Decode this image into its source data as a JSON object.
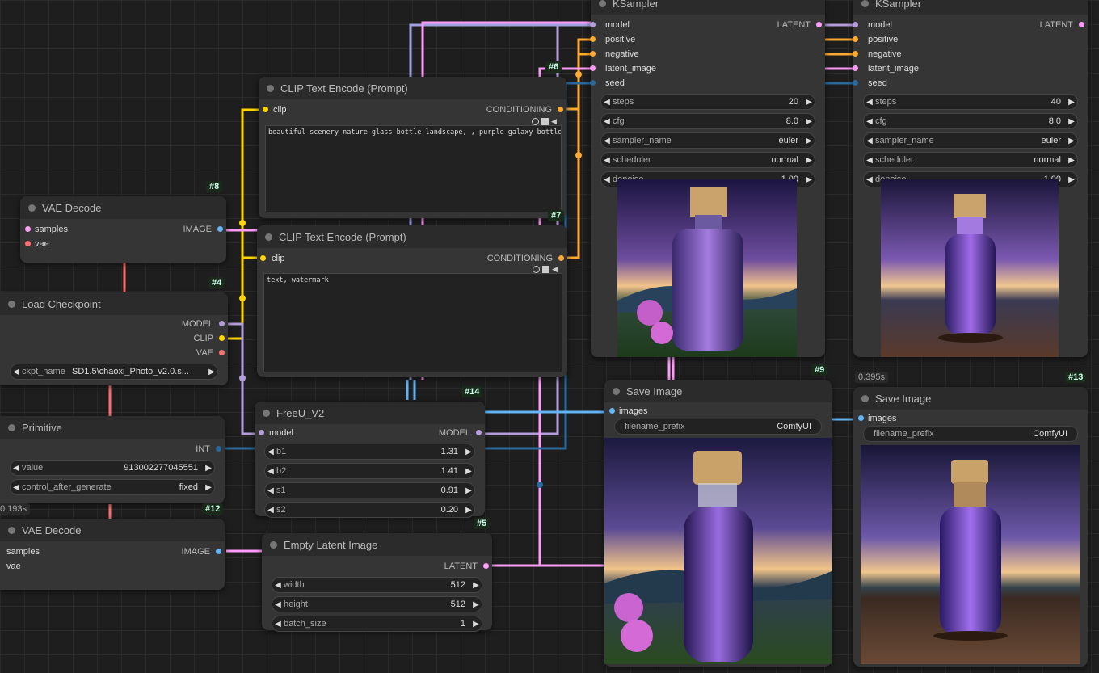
{
  "colors": {
    "model": "#b39ddb",
    "clip": "#ffd500",
    "conditioning": "#ffa931",
    "latent": "#ff9cf9",
    "image": "#64b5f6",
    "vae": "#ff6e6e",
    "int": "#29699c"
  },
  "ksampler_a": {
    "title": "KSampler",
    "output": "LATENT",
    "inputs": [
      "model",
      "positive",
      "negative",
      "latent_image",
      "seed"
    ],
    "widgets": [
      {
        "label": "steps",
        "value": "20"
      },
      {
        "label": "cfg",
        "value": "8.0"
      },
      {
        "label": "sampler_name",
        "value": "euler"
      },
      {
        "label": "scheduler",
        "value": "normal"
      },
      {
        "label": "denoise",
        "value": "1.00"
      }
    ]
  },
  "ksampler_b": {
    "title": "KSampler",
    "output": "LATENT",
    "inputs": [
      "model",
      "positive",
      "negative",
      "latent_image",
      "seed"
    ],
    "widgets": [
      {
        "label": "steps",
        "value": "40"
      },
      {
        "label": "cfg",
        "value": "8.0"
      },
      {
        "label": "sampler_name",
        "value": "euler"
      },
      {
        "label": "scheduler",
        "value": "normal"
      },
      {
        "label": "denoise",
        "value": "1.00"
      }
    ]
  },
  "clip_pos": {
    "title": "CLIP Text Encode (Prompt)",
    "input": "clip",
    "output": "CONDITIONING",
    "text": "beautiful scenery nature glass bottle landscape, , purple galaxy bottle,",
    "badge": "#6"
  },
  "clip_neg": {
    "title": "CLIP Text Encode (Prompt)",
    "input": "clip",
    "output": "CONDITIONING",
    "text": "text, watermark",
    "badge": "#7"
  },
  "vae_decode_a": {
    "title": "VAE Decode",
    "inputs": [
      "samples",
      "vae"
    ],
    "output": "IMAGE",
    "badge": "#8"
  },
  "checkpoint": {
    "title": "Load Checkpoint",
    "outputs": [
      "MODEL",
      "CLIP",
      "VAE"
    ],
    "widget": {
      "label": "ckpt_name",
      "value": "SD1.5\\chaoxi_Photo_v2.0.s..."
    },
    "badge": "#4"
  },
  "primitive": {
    "title": "Primitive",
    "output": "INT",
    "widgets": [
      {
        "label": "value",
        "value": "913002277045551"
      },
      {
        "label": "control_after_generate",
        "value": "fixed"
      }
    ],
    "timer": "0.193s"
  },
  "vae_decode_b": {
    "title": "VAE Decode",
    "inputs": [
      "samples",
      "vae"
    ],
    "output": "IMAGE",
    "badge": "#12"
  },
  "freeu": {
    "title": "FreeU_V2",
    "input": "model",
    "output": "MODEL",
    "widgets": [
      {
        "label": "b1",
        "value": "1.31"
      },
      {
        "label": "b2",
        "value": "1.41"
      },
      {
        "label": "s1",
        "value": "0.91"
      },
      {
        "label": "s2",
        "value": "0.20"
      }
    ],
    "badge": "#14"
  },
  "empty_latent": {
    "title": "Empty Latent Image",
    "output": "LATENT",
    "widgets": [
      {
        "label": "width",
        "value": "512"
      },
      {
        "label": "height",
        "value": "512"
      },
      {
        "label": "batch_size",
        "value": "1"
      }
    ],
    "badge": "#5"
  },
  "save_a": {
    "title": "Save Image",
    "input": "images",
    "widget": {
      "label": "filename_prefix",
      "value": "ComfyUI"
    },
    "badge": "#9"
  },
  "save_b": {
    "title": "Save Image",
    "input": "images",
    "widget": {
      "label": "filename_prefix",
      "value": "ComfyUI"
    },
    "badge": "#13",
    "timer": "0.395s"
  }
}
